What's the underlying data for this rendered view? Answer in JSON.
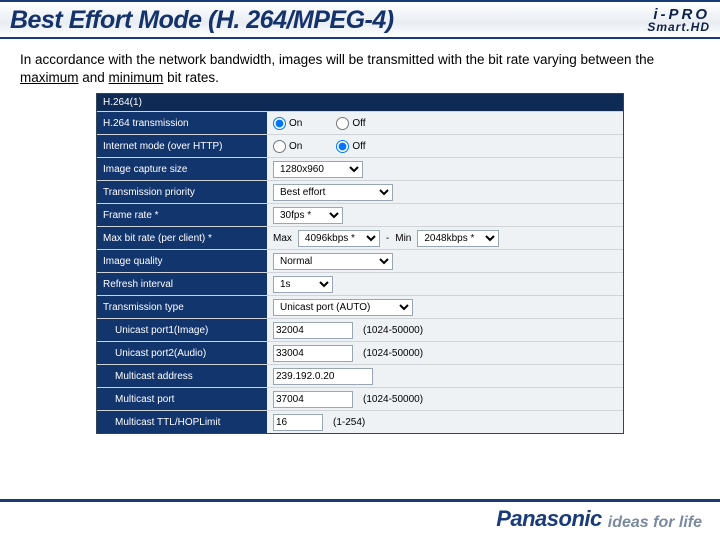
{
  "header": {
    "title": "Best Effort Mode (H. 264/MPEG-4)",
    "brand_top": "i-PRO",
    "brand_bot": "Smart.HD"
  },
  "intro": {
    "pre": "In accordance with the network bandwidth, images will be transmitted with the bit rate varying between the ",
    "max": "maximum",
    "mid": " and ",
    "min": "minimum",
    "post": " bit rates."
  },
  "section": {
    "title": "H.264(1)"
  },
  "rows": {
    "transmission": {
      "label": "H.264 transmission",
      "on": "On",
      "off": "Off"
    },
    "internet": {
      "label": "Internet mode (over HTTP)",
      "on": "On",
      "off": "Off"
    },
    "capsize": {
      "label": "Image capture size",
      "value": "1280x960"
    },
    "priority": {
      "label": "Transmission priority",
      "value": "Best effort"
    },
    "framerate": {
      "label": "Frame rate *",
      "value": "30fps *"
    },
    "bitrate": {
      "label": "Max bit rate (per client) *",
      "maxlbl": "Max",
      "maxval": "4096kbps *",
      "dash": "-",
      "minlbl": "Min",
      "minval": "2048kbps *"
    },
    "quality": {
      "label": "Image quality",
      "value": "Normal"
    },
    "refresh": {
      "label": "Refresh interval",
      "value": "1s"
    },
    "txtype": {
      "label": "Transmission type",
      "value": "Unicast port (AUTO)"
    },
    "uport1": {
      "label": "Unicast port1(Image)",
      "value": "32004",
      "hint": "(1024-50000)"
    },
    "uport2": {
      "label": "Unicast port2(Audio)",
      "value": "33004",
      "hint": "(1024-50000)"
    },
    "maddr": {
      "label": "Multicast address",
      "value": "239.192.0.20"
    },
    "mport": {
      "label": "Multicast port",
      "value": "37004",
      "hint": "(1024-50000)"
    },
    "mttl": {
      "label": "Multicast TTL/HOPLimit",
      "value": "16",
      "hint": "(1-254)"
    }
  },
  "footer": {
    "brand": "Panasonic",
    "tag": "ideas for life"
  }
}
